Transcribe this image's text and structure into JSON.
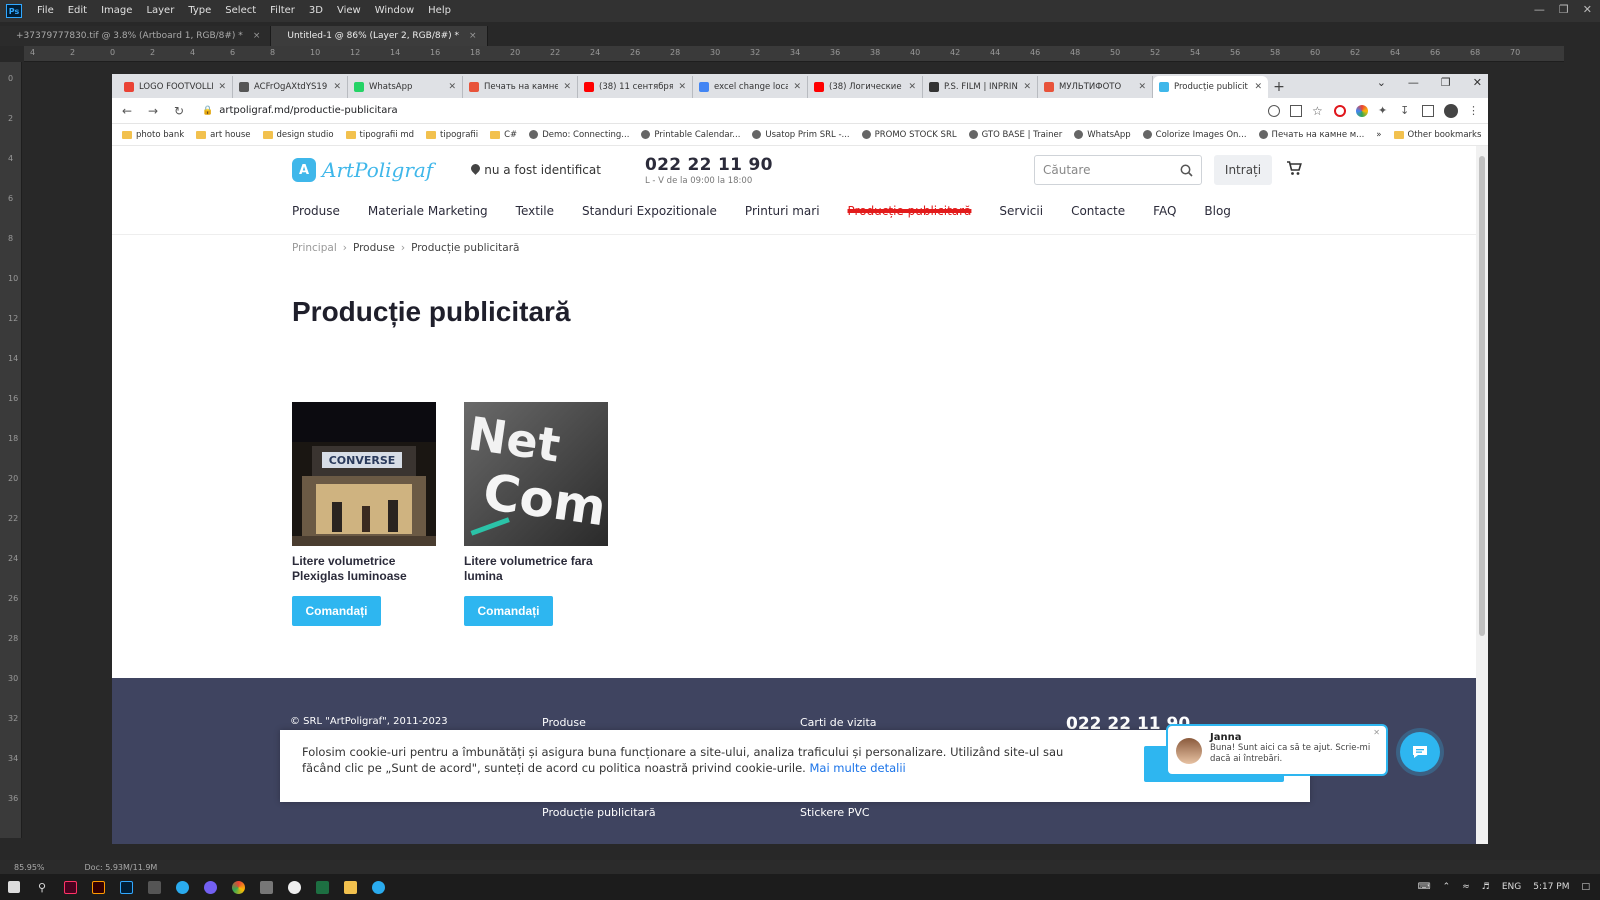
{
  "photoshop": {
    "menu": [
      "File",
      "Edit",
      "Image",
      "Layer",
      "Type",
      "Select",
      "Filter",
      "3D",
      "View",
      "Window",
      "Help"
    ],
    "doc_tabs": [
      {
        "label": "+37379777830.tif @ 3.8% (Artboard 1, RGB/8#) *",
        "active": false
      },
      {
        "label": "Untitled-1 @ 86% (Layer 2, RGB/8#) *",
        "active": true
      }
    ],
    "ruler_h": [
      "4",
      "2",
      "0",
      "2",
      "4",
      "6",
      "8",
      "10",
      "12",
      "14",
      "16",
      "18",
      "20",
      "22",
      "24",
      "26",
      "28",
      "30",
      "32",
      "34",
      "36",
      "38",
      "40",
      "42",
      "44",
      "46",
      "48",
      "50",
      "52",
      "54",
      "56",
      "58",
      "60",
      "62",
      "64",
      "66",
      "68",
      "70"
    ],
    "ruler_v": [
      "0",
      "2",
      "4",
      "6",
      "8",
      "10",
      "12",
      "14",
      "16",
      "18",
      "20",
      "22",
      "24",
      "26",
      "28",
      "30",
      "32",
      "34",
      "36"
    ],
    "status_zoom": "85.95%",
    "status_doc": "Doc: 5.93M/11.9M"
  },
  "browser": {
    "tabs": [
      {
        "title": "LOGO FOOTVOLLE",
        "color": "#ea4335",
        "icon": "gmail-icon",
        "active": false
      },
      {
        "title": "ACFrOgAXtdYS19I",
        "color": "#555555",
        "icon": "globe-icon",
        "active": false
      },
      {
        "title": "WhatsApp",
        "color": "#25d366",
        "icon": "whatsapp-icon",
        "active": false
      },
      {
        "title": "Печать на камне",
        "color": "#e8533a",
        "icon": "site-icon",
        "active": false
      },
      {
        "title": "(38) 11 сентября",
        "color": "#ff0000",
        "icon": "youtube-icon",
        "active": false
      },
      {
        "title": "excel change local",
        "color": "#4285f4",
        "icon": "google-icon",
        "active": false
      },
      {
        "title": "(38) Логические",
        "color": "#ff0000",
        "icon": "youtube-icon",
        "active": false
      },
      {
        "title": "P.S. FILM | INPRINT",
        "color": "#333333",
        "icon": "site-icon",
        "active": false
      },
      {
        "title": "МУЛЬТИФОТО",
        "color": "#e8533a",
        "icon": "site-icon",
        "active": false
      },
      {
        "title": "Producție publicit",
        "color": "#3fb7ea",
        "icon": "artpoligraf-icon",
        "active": true
      }
    ],
    "url": "artpoligraf.md/productie-publicitara",
    "bookmarks": [
      {
        "label": "photo bank",
        "type": "folder"
      },
      {
        "label": "art house",
        "type": "folder"
      },
      {
        "label": "design studio",
        "type": "folder"
      },
      {
        "label": "tipografii md",
        "type": "folder"
      },
      {
        "label": "tipografii",
        "type": "folder"
      },
      {
        "label": "C#",
        "type": "folder"
      },
      {
        "label": "Demo: Connecting...",
        "type": "site"
      },
      {
        "label": "Printable Calendar...",
        "type": "site"
      },
      {
        "label": "Usatop Prim SRL -...",
        "type": "site"
      },
      {
        "label": "PROMO STOCK SRL",
        "type": "site"
      },
      {
        "label": "GTO BASE | Trainer",
        "type": "site"
      },
      {
        "label": "WhatsApp",
        "type": "site"
      },
      {
        "label": "Colorize Images On...",
        "type": "site"
      },
      {
        "label": "Печать на камне м...",
        "type": "site"
      }
    ],
    "bookmarks_more": "»",
    "other_bookmarks": "Other bookmarks"
  },
  "site": {
    "logo_text": "ArtPoligraf",
    "location": "nu a fost identificat",
    "phone": "022 22 11 90",
    "hours": "L - V de la 09:00 la 18:00",
    "search_placeholder": "Căutare",
    "login": "Intrați",
    "nav": [
      "Produse",
      "Materiale Marketing",
      "Textile",
      "Standuri Expozitionale",
      "Printuri mari",
      "Producție publicitară",
      "Servicii",
      "Contacte",
      "FAQ",
      "Blog"
    ],
    "nav_active_index": 5,
    "breadcrumb": [
      "Principal",
      "Produse",
      "Producție publicitară"
    ],
    "title": "Producție publicitară",
    "products": [
      {
        "title": "Litere volumetrice Plexiglas luminoase",
        "button": "Comandați"
      },
      {
        "title": "Litere volumetrice fara lumina",
        "button": "Comandați"
      }
    ],
    "footer": {
      "copyright": "© SRL \"ArtPoligraf\", 2011-2023",
      "col2": "Produse",
      "col3": "Carti de vizita",
      "phone": "022 22 11 90",
      "col2_bottom": "Producție publicitară",
      "col3_bottom": "Stickere PVC"
    },
    "cookie": {
      "text": "Folosim cookie-uri pentru a îmbunătăți și asigura buna funcționare a site-ului, analiza traficului și personalizare. Utilizând site-ul sau făcând clic pe „Sunt de acord\", sunteți de acord cu politica noastră privind cookie-urile.",
      "link": "Mai multe detalii"
    },
    "chat": {
      "name": "Janna",
      "message": "Buna! Sunt aici ca să te ajut. Scrie-mi dacă ai întrebări."
    }
  },
  "taskbar": {
    "lang": "ENG",
    "time": "5:17 PM"
  }
}
